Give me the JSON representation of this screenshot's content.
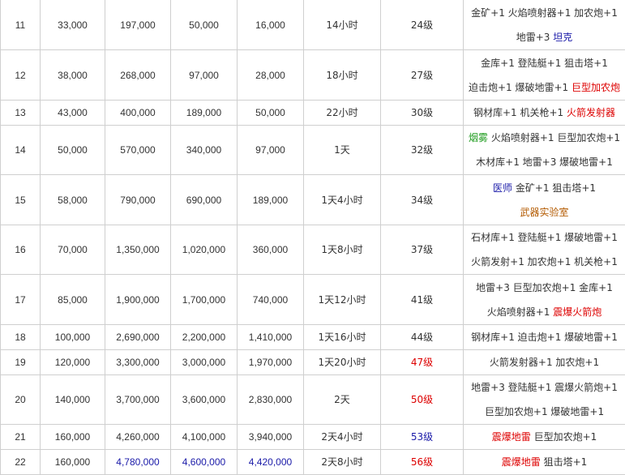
{
  "colors": {
    "default": "#333333",
    "red": "#dd0000",
    "blue": "#1a1aa8",
    "green": "#1e9b1e",
    "brown": "#b35a00",
    "border": "#cfcfcf"
  },
  "rows": [
    {
      "level": "11",
      "c1": "33,000",
      "c2": "197,000",
      "c3": "50,000",
      "c4": "16,000",
      "time": "14小时",
      "hq": "24级",
      "notes": [
        [
          {
            "t": "金矿+1 火焰喷射器+1 加农炮+1"
          }
        ],
        [
          {
            "t": "地雷+3 "
          },
          {
            "t": "坦克",
            "c": "blue"
          }
        ]
      ]
    },
    {
      "level": "12",
      "c1": "38,000",
      "c2": "268,000",
      "c3": "97,000",
      "c4": "28,000",
      "time": "18小时",
      "hq": "27级",
      "notes": [
        [
          {
            "t": "金库+1 登陆艇+1 狙击塔+1"
          }
        ],
        [
          {
            "t": "迫击炮+1 爆破地雷+1 "
          },
          {
            "t": "巨型加农炮",
            "c": "red"
          }
        ]
      ]
    },
    {
      "level": "13",
      "c1": "43,000",
      "c2": "400,000",
      "c3": "189,000",
      "c4": "50,000",
      "time": "22小时",
      "hq": "30级",
      "notes": [
        [
          {
            "t": "钢材库+1 机关枪+1 "
          },
          {
            "t": "火箭发射器",
            "c": "red"
          }
        ]
      ]
    },
    {
      "level": "14",
      "c1": "50,000",
      "c2": "570,000",
      "c3": "340,000",
      "c4": "97,000",
      "time": "1天",
      "hq": "32级",
      "notes": [
        [
          {
            "t": "烟雾",
            "c": "green"
          },
          {
            "t": " 火焰喷射器+1 巨型加农炮+1"
          }
        ],
        [
          {
            "t": "木材库+1 地雷+3 爆破地雷+1"
          }
        ]
      ]
    },
    {
      "level": "15",
      "c1": "58,000",
      "c2": "790,000",
      "c3": "690,000",
      "c4": "189,000",
      "time": "1天4小时",
      "hq": "34级",
      "notes": [
        [
          {
            "t": "医师",
            "c": "blue"
          },
          {
            "t": " 金矿+1 狙击塔+1"
          }
        ],
        [
          {
            "t": "武器实验室",
            "c": "brown"
          }
        ]
      ]
    },
    {
      "level": "16",
      "c1": "70,000",
      "c2": "1,350,000",
      "c3": "1,020,000",
      "c4": "360,000",
      "time": "1天8小时",
      "hq": "37级",
      "notes": [
        [
          {
            "t": "石材库+1 登陆艇+1 爆破地雷+1"
          }
        ],
        [
          {
            "t": "火箭发射+1 加农炮+1 机关枪+1"
          }
        ]
      ]
    },
    {
      "level": "17",
      "c1": "85,000",
      "c2": "1,900,000",
      "c3": "1,700,000",
      "c4": "740,000",
      "time": "1天12小时",
      "hq": "41级",
      "notes": [
        [
          {
            "t": "地雷+3 巨型加农炮+1 金库+1"
          }
        ],
        [
          {
            "t": "火焰喷射器+1 "
          },
          {
            "t": "震爆火箭炮",
            "c": "red"
          }
        ]
      ]
    },
    {
      "level": "18",
      "c1": "100,000",
      "c2": "2,690,000",
      "c3": "2,200,000",
      "c4": "1,410,000",
      "time": "1天16小时",
      "hq": "44级",
      "notes": [
        [
          {
            "t": "钢材库+1 迫击炮+1 爆破地雷+1"
          }
        ]
      ]
    },
    {
      "level": "19",
      "c1": "120,000",
      "c2": "3,300,000",
      "c3": "3,000,000",
      "c4": "1,970,000",
      "time": "1天20小时",
      "hq": "47级",
      "hq_color": "red",
      "notes": [
        [
          {
            "t": "火箭发射器+1 加农炮+1"
          }
        ]
      ]
    },
    {
      "level": "20",
      "c1": "140,000",
      "c2": "3,700,000",
      "c3": "3,600,000",
      "c4": "2,830,000",
      "time": "2天",
      "hq": "50级",
      "hq_color": "red",
      "notes": [
        [
          {
            "t": "地雷+3 登陆艇+1 震爆火箭炮+1"
          }
        ],
        [
          {
            "t": "巨型加农炮+1 爆破地雷+1"
          }
        ]
      ]
    },
    {
      "level": "21",
      "c1": "160,000",
      "c2": "4,260,000",
      "c3": "4,100,000",
      "c4": "3,940,000",
      "time": "2天4小时",
      "hq": "53级",
      "hq_color": "blue",
      "notes": [
        [
          {
            "t": "震爆地雷",
            "c": "red"
          },
          {
            "t": " 巨型加农炮+1"
          }
        ]
      ]
    },
    {
      "level": "22",
      "c1": "160,000",
      "c2": "4,780,000",
      "c3": "4,600,000",
      "c4": "4,420,000",
      "time": "2天8小时",
      "hq": "56级",
      "hq_color": "red",
      "num_color": "blue",
      "notes": [
        [
          {
            "t": "震爆地雷",
            "c": "red"
          },
          {
            "t": " 狙击塔+1"
          }
        ]
      ]
    }
  ]
}
